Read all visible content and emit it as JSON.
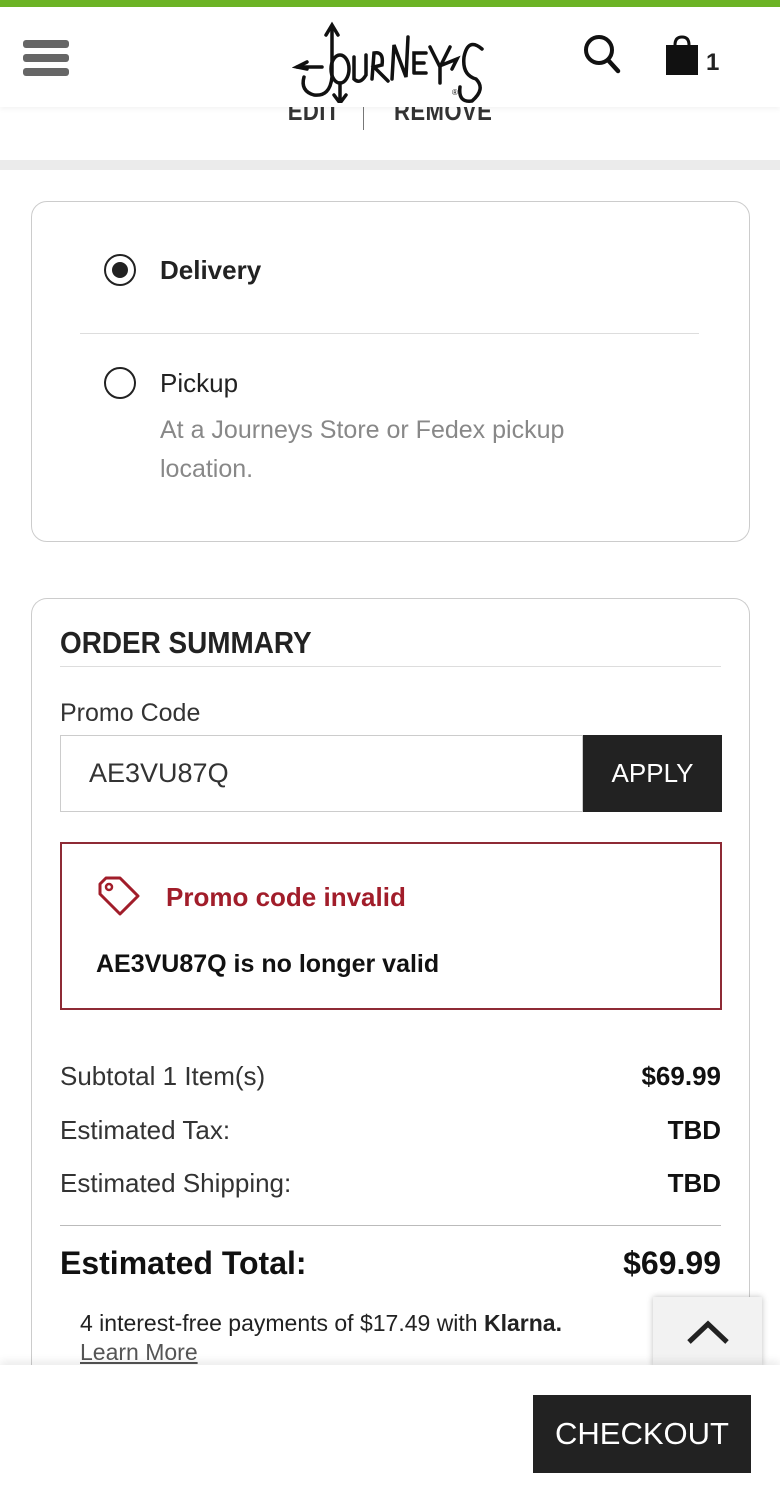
{
  "brand": {
    "name": "Journeys",
    "accent": "#6cb325"
  },
  "header": {
    "cart_count": "1"
  },
  "item_actions": {
    "edit": "EDIT",
    "remove": "REMOVE"
  },
  "fulfillment": {
    "options": [
      {
        "label": "Delivery",
        "selected": true
      },
      {
        "label": "Pickup",
        "selected": false,
        "description": "At a Journeys Store or Fedex pickup location."
      }
    ]
  },
  "summary": {
    "title": "ORDER SUMMARY",
    "promo_label": "Promo Code",
    "promo_value": "AE3VU87Q",
    "apply_label": "APPLY",
    "error": {
      "title": "Promo code invalid",
      "message": "AE3VU87Q is no longer valid",
      "color": "#a11d2a"
    },
    "rows": [
      {
        "label": "Subtotal 1 Item(s)",
        "value": "$69.99"
      },
      {
        "label": "Estimated Tax:",
        "value": "TBD"
      },
      {
        "label": "Estimated Shipping:",
        "value": "TBD"
      }
    ],
    "total_label": "Estimated Total:",
    "total_value": "$69.99",
    "klarna_text": "4 interest-free payments of $17.49 with ",
    "klarna_brand": "Klarna.",
    "learn_more": "Learn More"
  },
  "checkout_label": "CHECKOUT"
}
